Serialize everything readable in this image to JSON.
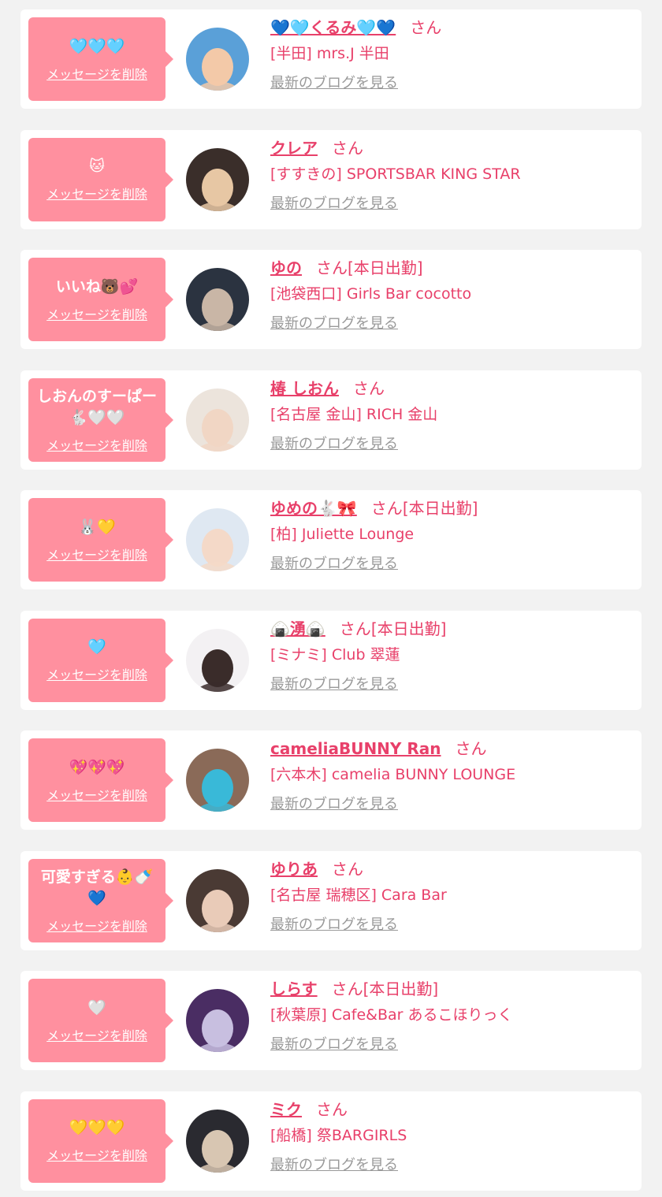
{
  "entries": [
    {
      "message": "🩵🩵🩵",
      "delete_label": "メッセージを削除",
      "name": "💙🩵くるみ🩵💙",
      "honorific": "さん",
      "status": "",
      "shop": "[半田] mrs.J 半田",
      "blog_label": "最新のブログを見る",
      "avatar_colors": [
        "#5aa0d8",
        "#f3c9a8"
      ]
    },
    {
      "message": "🐱",
      "delete_label": "メッセージを削除",
      "name": "クレア",
      "honorific": "さん",
      "status": "",
      "shop": "[すすきの] SPORTSBAR KING STAR",
      "blog_label": "最新のブログを見る",
      "avatar_colors": [
        "#3a2e2a",
        "#e7c7a4"
      ]
    },
    {
      "message": "いいね🐻💕",
      "delete_label": "メッセージを削除",
      "name": "ゆの",
      "honorific": "さん",
      "status": "[本日出勤]",
      "shop": "[池袋西口] Girls Bar cocotto",
      "blog_label": "最新のブログを見る",
      "avatar_colors": [
        "#2b3340",
        "#c9b6a6"
      ]
    },
    {
      "message": "しおんのすーぱー🐇🤍🤍",
      "delete_label": "メッセージを削除",
      "name": "椿 しおん",
      "honorific": "さん",
      "status": "",
      "shop": "[名古屋 金山] RICH 金山",
      "blog_label": "最新のブログを見る",
      "avatar_colors": [
        "#ece4dc",
        "#f1d6c4"
      ]
    },
    {
      "message": "🐰💛",
      "delete_label": "メッセージを削除",
      "name": "ゆめの🐇🎀",
      "honorific": "さん",
      "status": "[本日出勤]",
      "shop": "[柏] Juliette Lounge",
      "blog_label": "最新のブログを見る",
      "avatar_colors": [
        "#dfe8f2",
        "#f4d9c8"
      ]
    },
    {
      "message": "🩵",
      "delete_label": "メッセージを削除",
      "name": "🍙湧🍙",
      "honorific": "さん",
      "status": "[本日出勤]",
      "shop": "[ミナミ] Club 翠蓮",
      "blog_label": "最新のブログを見る",
      "avatar_colors": [
        "#f3f1f3",
        "#3a2c2a"
      ]
    },
    {
      "message": "💖💖💖",
      "delete_label": "メッセージを削除",
      "name": "cameliaBUNNY Ran",
      "honorific": "さん",
      "status": "",
      "shop": "[六本木] camelia BUNNY LOUNGE",
      "blog_label": "最新のブログを見る",
      "avatar_colors": [
        "#8a6a58",
        "#39b9d8"
      ]
    },
    {
      "message": "可愛すぎる👶🍼💙",
      "delete_label": "メッセージを削除",
      "name": "ゆりあ",
      "honorific": "さん",
      "status": "",
      "shop": "[名古屋 瑞穂区] Cara Bar",
      "blog_label": "最新のブログを見る",
      "avatar_colors": [
        "#4a3a34",
        "#e9cbb8"
      ]
    },
    {
      "message": "🤍",
      "delete_label": "メッセージを削除",
      "name": "しらす",
      "honorific": "さん",
      "status": "[本日出勤]",
      "shop": "[秋葉原] Cafe&Bar あるこほりっく",
      "blog_label": "最新のブログを見る",
      "avatar_colors": [
        "#4a2d63",
        "#c8bfe0"
      ]
    },
    {
      "message": "💛💛💛",
      "delete_label": "メッセージを削除",
      "name": "ミク",
      "honorific": "さん",
      "status": "",
      "shop": "[船橋] 祭BARGIRLS",
      "blog_label": "最新のブログを見る",
      "avatar_colors": [
        "#2a2a30",
        "#d8c6b2"
      ]
    }
  ]
}
